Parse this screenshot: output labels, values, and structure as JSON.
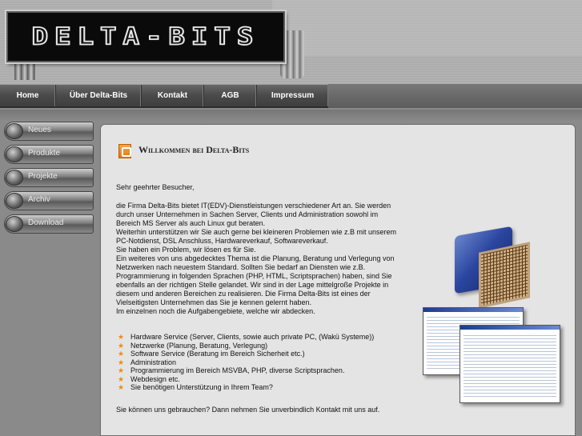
{
  "header": {
    "logo_text": "DELTA-BITS"
  },
  "nav": {
    "items": [
      {
        "label": "Home"
      },
      {
        "label": "Über Delta-Bits"
      },
      {
        "label": "Kontakt"
      },
      {
        "label": "AGB"
      },
      {
        "label": "Impressum"
      }
    ]
  },
  "sidebar": {
    "items": [
      {
        "label": "Neues"
      },
      {
        "label": "Produkte"
      },
      {
        "label": "Projekte"
      },
      {
        "label": "Archiv"
      },
      {
        "label": "Download"
      }
    ]
  },
  "main": {
    "title": "Willkommen bei Delta-Bits",
    "greeting": "Sehr geehrter Besucher,",
    "intro_lines": [
      "die Firma Delta-Bits bietet IT(EDV)-Dienstleistungen verschiedener Art an. Sie werden",
      "durch unser Unternehmen in Sachen Server, Clients und Administration sowohl im",
      "Bereich MS Server als auch Linux gut beraten.",
      "Weiterhin unterstützen wir Sie auch gerne bei kleineren Problemen wie z.B mit unserem",
      "PC-Notdienst, DSL Anschluss, Hardwareverkauf, Softwareverkauf.",
      "Sie haben ein Problem, wir lösen es für Sie.",
      "Ein weiteres von uns abgedecktes Thema ist die Planung, Beratung und Verlegung von",
      "Netzwerken nach neuestem Standard. Sollten Sie bedarf an Diensten wie z.B.",
      "Programmierung in folgenden Sprachen (PHP, HTML, Scriptsprachen) haben, sind Sie",
      "ebenfalls an der richtigen Stelle gelandet. Wir sind in der Lage mittelgroße Projekte in",
      "diesem und anderen Bereichen zu realisieren. Die Firma Delta-Bits ist eines der",
      "Vielseitigsten Unternehmen das Sie je kennen gelernt haben.",
      "Im einzelnen noch die Aufgabengebiete, welche wir abdecken."
    ],
    "services": [
      "Hardware Service (Server, Clients, sowie auch private PC, (Wakü Systeme))",
      "Netzwerke (Planung, Beratung, Verlegung)",
      "Software Service (Beratung im Bereich Sicherheit etc.)",
      "Administration",
      "Programmierung im Bereich MSVBA, PHP, diverse Scriptsprachen.",
      "Webdesign etc.",
      "Sie benötigen Unterstützung in Ihrem Team?"
    ],
    "closing": "Sie können uns gebrauchen? Dann nehmen Sie unverbindlich Kontakt mit uns auf."
  },
  "colors": {
    "accent": "#f08a18",
    "nav_bg": "#4a4a4a",
    "content_bg": "#e4e4e4"
  },
  "icons": {
    "title_icon": "orange-box-icon",
    "bullet": "star-icon"
  }
}
